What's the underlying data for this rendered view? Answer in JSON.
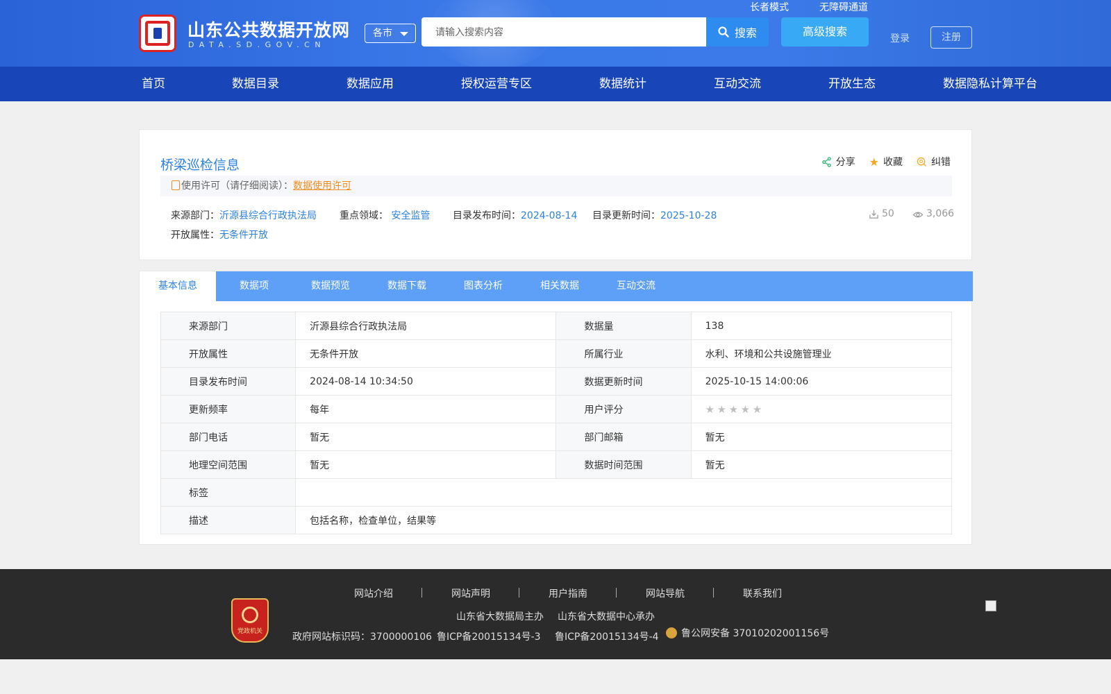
{
  "header": {
    "site_title": "山东公共数据开放网",
    "site_sub": "DATA.SD.GOV.CN",
    "city_select": "各市",
    "search_placeholder": "请输入搜索内容",
    "search_btn": "搜索",
    "adv_search": "高级搜索",
    "elder_mode": "长者模式",
    "accessibility": "无障碍通道",
    "login": "登录",
    "register": "注册"
  },
  "nav": [
    "首页",
    "数据目录",
    "数据应用",
    "授权运营专区",
    "数据统计",
    "互动交流",
    "开放生态",
    "数据隐私计算平台"
  ],
  "dataset": {
    "title": "桥梁巡检信息",
    "actions": {
      "share": "分享",
      "favorite": "收藏",
      "report": "纠错"
    },
    "license_label": "使用许可（请仔细阅读）：",
    "license_link": "数据使用许可",
    "source_label": "来源部门：",
    "source_value": "沂源县综合行政执法局",
    "domain_label": "重点领域：",
    "domain_value": "安全监管",
    "publish_label": "目录发布时间：",
    "publish_value": "2024-08-14",
    "update_label": "目录更新时间：",
    "update_value": "2025-10-28",
    "open_label": "开放属性：",
    "open_value": "无条件开放",
    "downloads": "50",
    "views": "3,066"
  },
  "tabs": [
    "基本信息",
    "数据项",
    "数据预览",
    "数据下载",
    "图表分析",
    "相关数据",
    "互动交流"
  ],
  "info": {
    "r1": {
      "l1": "来源部门",
      "v1": "沂源县综合行政执法局",
      "l2": "数据量",
      "v2": "138"
    },
    "r2": {
      "l1": "开放属性",
      "v1": "无条件开放",
      "l2": "所属行业",
      "v2": "水利、环境和公共设施管理业"
    },
    "r3": {
      "l1": "目录发布时间",
      "v1": "2024-08-14 10:34:50",
      "l2": "数据更新时间",
      "v2": "2025-10-15 14:00:06"
    },
    "r4": {
      "l1": "更新频率",
      "v1": "每年",
      "l2": "用户评分"
    },
    "r5": {
      "l1": "部门电话",
      "v1": "暂无",
      "l2": "部门邮箱",
      "v2": "暂无"
    },
    "r6": {
      "l1": "地理空间范围",
      "v1": "暂无",
      "l2": "数据时间范围",
      "v2": "暂无"
    },
    "r7": {
      "l1": "标签",
      "v1": ""
    },
    "r8": {
      "l1": "描述",
      "v1": "包括名称，检查单位，结果等"
    },
    "rating": 0
  },
  "footer": {
    "links": [
      "网站介绍",
      "网站声明",
      "用户指南",
      "网站导航",
      "联系我们"
    ],
    "host": "山东省大数据局主办",
    "organizer": "山东省大数据中心承办",
    "gov_id": "政府网站标识码：3700000106",
    "icp3": "鲁ICP备20015134号-3",
    "icp4": "鲁ICP备20015134号-4",
    "police": "鲁公网安备 37010202001156号",
    "badge_text": "党政机关"
  }
}
